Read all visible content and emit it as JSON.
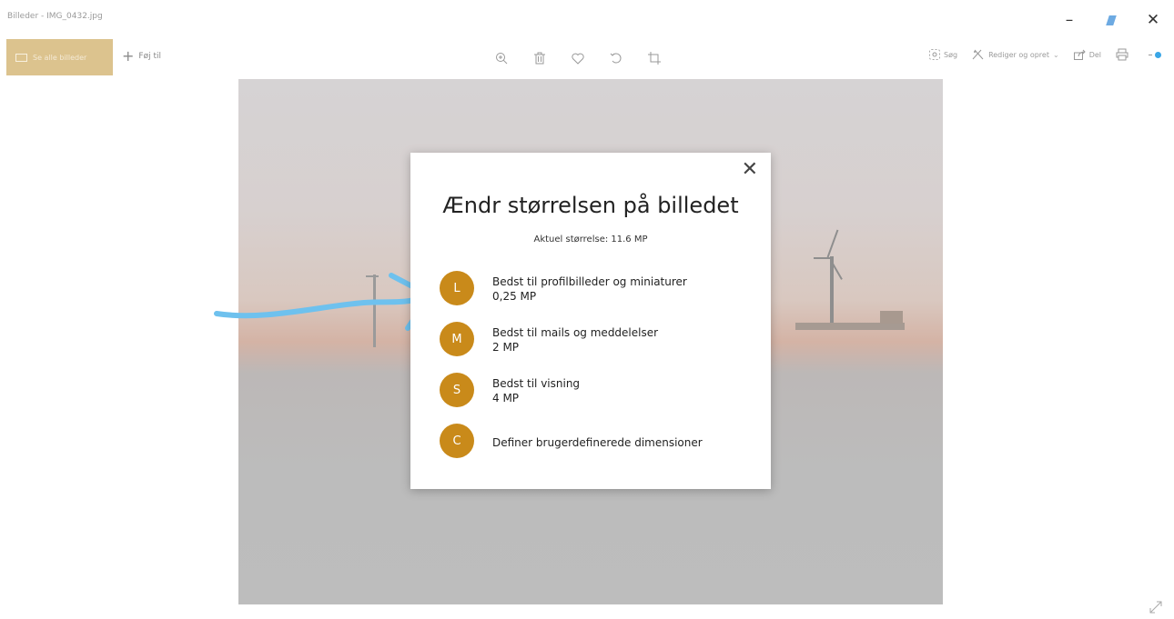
{
  "window": {
    "title": "Billeder - IMG_0432.jpg"
  },
  "toolbar": {
    "see_all": "Se alle billeder",
    "add": "Føj til",
    "search": "Søg",
    "edit_create": "Rediger og opret",
    "share": "Del"
  },
  "dialog": {
    "title": "Ændr størrelsen på billedet",
    "current": "Aktuel størrelse: 11.6 MP",
    "options": [
      {
        "letter": "L",
        "label": "Bedst til profilbilleder og miniaturer",
        "size": "0,25 MP"
      },
      {
        "letter": "M",
        "label": "Bedst til mails og meddelelser",
        "size": "2 MP"
      },
      {
        "letter": "S",
        "label": "Bedst til visning",
        "size": "4 MP"
      },
      {
        "letter": "C",
        "label": "Definer brugerdefinerede dimensioner",
        "size": ""
      }
    ]
  },
  "colors": {
    "accent": "#c98a1a",
    "arrow": "#6ec1ee",
    "see_all_bg": "#dcc38e"
  }
}
